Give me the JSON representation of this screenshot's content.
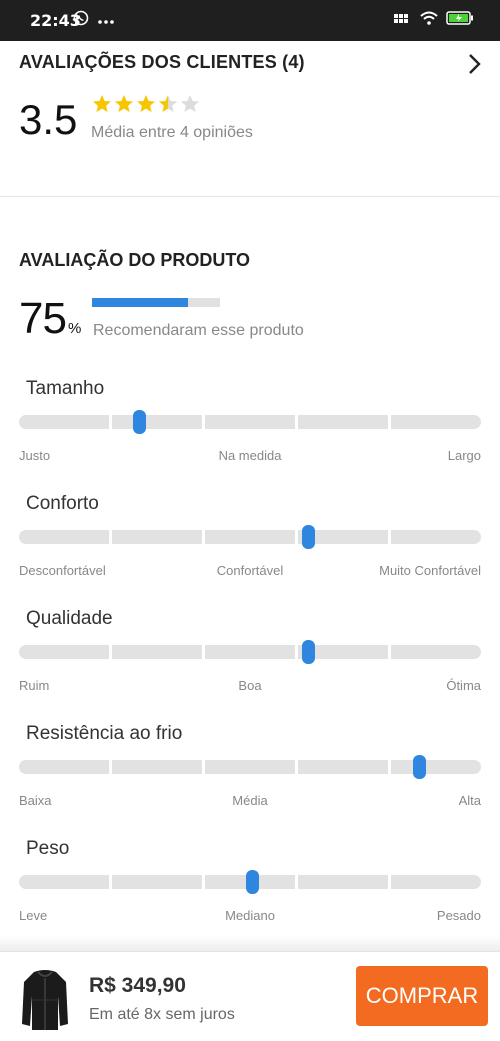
{
  "status_bar": {
    "time": "22:43",
    "icons": [
      "whatsapp-icon",
      "more-icon",
      "signal-icon",
      "wifi-icon",
      "battery-icon"
    ]
  },
  "reviews": {
    "title": "AVALIAÇÕES DOS CLIENTES (4)",
    "rating": "3.5",
    "stars": 3.5,
    "stars_max": 5,
    "subtitle": "Média entre 4 opiniões"
  },
  "product_eval": {
    "title": "AVALIAÇÃO DO PRODUTO",
    "percent": "75",
    "percent_sign": "%",
    "percent_value": 0.75,
    "percent_text": "Recomendaram esse produto",
    "attributes": [
      {
        "name": "Tamanho",
        "left": "Justo",
        "center": "Na medida",
        "right": "Largo",
        "value": 0.26
      },
      {
        "name": "Conforto",
        "left": "Desconfortável",
        "center": "Confortável",
        "right": "Muito Confortável",
        "value": 0.625
      },
      {
        "name": "Qualidade",
        "left": "Ruim",
        "center": "Boa",
        "right": "Ótima",
        "value": 0.625
      },
      {
        "name": "Resistência ao frio",
        "left": "Baixa",
        "center": "Média",
        "right": "Alta",
        "value": 0.865
      },
      {
        "name": "Peso",
        "left": "Leve",
        "center": "Mediano",
        "right": "Pesado",
        "value": 0.505
      }
    ]
  },
  "bottom_bar": {
    "price": "R$ 349,90",
    "installments": "Em até 8x sem juros",
    "buy_label": "COMPRAR"
  },
  "colors": {
    "accent_blue": "#2e86de",
    "buy_orange": "#f26b21",
    "star_yellow": "#f7c600"
  }
}
